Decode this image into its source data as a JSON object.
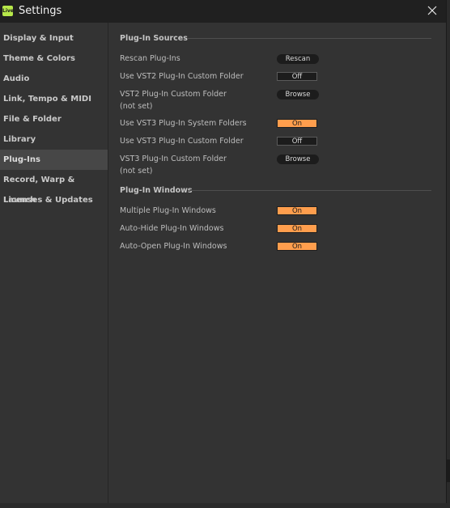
{
  "window": {
    "title": "Settings",
    "app_logo_text": "Live"
  },
  "sidebar": {
    "items": [
      {
        "label": "Display & Input"
      },
      {
        "label": "Theme & Colors"
      },
      {
        "label": "Audio"
      },
      {
        "label": "Link, Tempo & MIDI"
      },
      {
        "label": "File & Folder"
      },
      {
        "label": "Library"
      },
      {
        "label": "Plug-Ins",
        "active": true
      },
      {
        "label": "Record, Warp & Launch"
      },
      {
        "label": "Licenses & Updates"
      }
    ]
  },
  "main": {
    "sources": {
      "title": "Plug-In Sources",
      "rescan": {
        "label": "Rescan Plug-Ins",
        "button": "Rescan"
      },
      "vst2_custom_use": {
        "label": "Use VST2 Plug-In Custom Folder",
        "value": "Off"
      },
      "vst2_custom_folder": {
        "label": "VST2 Plug-In Custom Folder",
        "sub": "(not set)",
        "button": "Browse"
      },
      "vst3_system_use": {
        "label": "Use VST3 Plug-In System Folders",
        "value": "On"
      },
      "vst3_custom_use": {
        "label": "Use VST3 Plug-In Custom Folder",
        "value": "Off"
      },
      "vst3_custom_folder": {
        "label": "VST3 Plug-In Custom Folder",
        "sub": "(not set)",
        "button": "Browse"
      }
    },
    "windows": {
      "title": "Plug-In Windows",
      "multiple": {
        "label": "Multiple Plug-In Windows",
        "value": "On"
      },
      "auto_hide": {
        "label": "Auto-Hide Plug-In Windows",
        "value": "On"
      },
      "auto_open": {
        "label": "Auto-Open Plug-In Windows",
        "value": "On"
      }
    }
  },
  "colors": {
    "accent_on": "#ff9e4d",
    "logo": "#b7e84a",
    "panel": "#333333",
    "titlebar": "#202020",
    "active_nav": "#474747"
  }
}
